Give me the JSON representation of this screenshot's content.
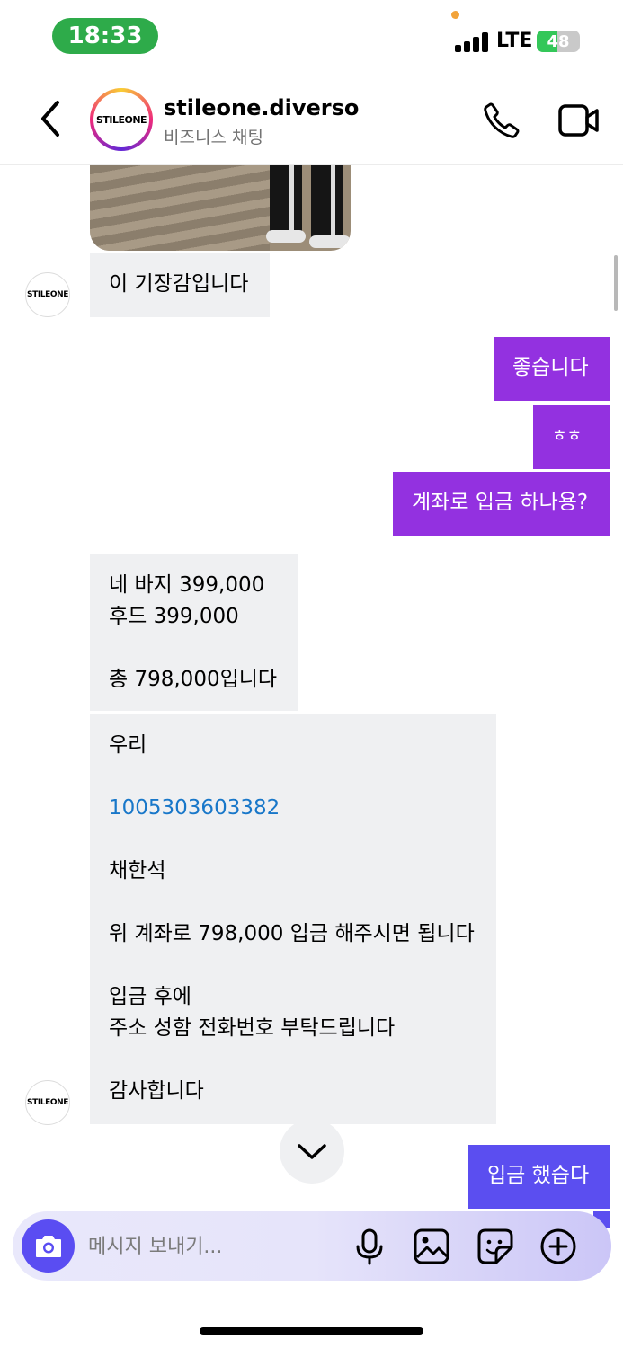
{
  "status": {
    "time": "18:33",
    "network": "LTE",
    "battery_level": 48,
    "battery_label": "48"
  },
  "header": {
    "avatar_text": "STILEONE",
    "name": "stileone.diverso",
    "subtitle": "비즈니스 채팅",
    "icons": [
      "chevron-left-icon",
      "phone-icon",
      "video-camera-icon"
    ]
  },
  "messages": [
    {
      "from": "them",
      "text": "이 기장감입니다"
    },
    {
      "from": "me",
      "text": "좋습니다"
    },
    {
      "from": "me",
      "text": "ㅎㅎ"
    },
    {
      "from": "me",
      "text": "계좌로 입금 하나용?"
    },
    {
      "from": "them",
      "text": "네 바지 399,000\n후드 399,000\n\n총 798,000입니다"
    },
    {
      "from": "them",
      "before_link": "우리\n\n",
      "link": "1005303603382",
      "after_link": "\n\n채한석\n\n위 계좌로 798,000 입금 해주시면 됩니다\n\n입금 후에\n주소 성함 전화번호 부탁드립니다\n\n감사합니다"
    },
    {
      "from": "me",
      "text": "입금 했습다"
    }
  ],
  "sender_avatar_text": "STILEONE",
  "composer": {
    "placeholder": "메시지 보내기...",
    "icons": [
      "camera-icon",
      "microphone-icon",
      "gallery-icon",
      "sticker-icon",
      "plus-circle-icon"
    ]
  },
  "colors": {
    "outgoing_bubble": "#9331e0",
    "outgoing_bubble_latest": "#5b4ef0",
    "incoming_bubble": "#eff0f2",
    "link": "#1877c9",
    "time_pill": "#2eab4a",
    "camera_button": "#5a4df2"
  }
}
